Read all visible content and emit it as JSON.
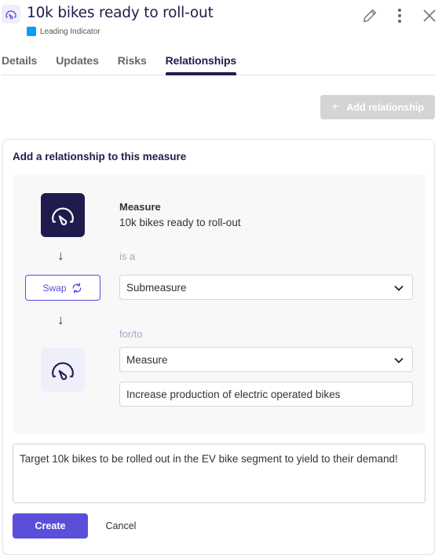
{
  "header": {
    "title": "10k bikes ready to roll-out",
    "title_icon": "gauge-icon",
    "tag": {
      "label": "Leading Indicator",
      "color": "#0b9cf7"
    },
    "actions": [
      {
        "name": "edit",
        "icon": "pencil-icon"
      },
      {
        "name": "more",
        "icon": "kebab-icon"
      },
      {
        "name": "close",
        "icon": "close-icon"
      }
    ]
  },
  "tabs": [
    {
      "label": "Details",
      "active": false
    },
    {
      "label": "Updates",
      "active": false
    },
    {
      "label": "Risks",
      "active": false
    },
    {
      "label": "Relationships",
      "active": true
    }
  ],
  "toolbar": {
    "add_relationship_label": "Add relationship",
    "add_relationship_icon": "plus-icon",
    "add_relationship_disabled": true
  },
  "form": {
    "title": "Add a relationship to this measure",
    "source": {
      "type_label": "Measure",
      "name": "10k bikes ready to roll-out",
      "icon": "gauge-icon"
    },
    "relation_label": "is a",
    "relation_select": {
      "value": "Submeasure"
    },
    "swap_label": "Swap",
    "swap_icon": "refresh-icon",
    "target_label": "for/to",
    "target_type_select": {
      "value": "Measure"
    },
    "target_value": "Increase production of electric operated bikes",
    "target_icon": "gauge-icon",
    "description": "Target 10k bikes to be rolled out in the EV bike segment to yield to their demand!",
    "create_label": "Create",
    "cancel_label": "Cancel"
  },
  "colors": {
    "primary": "#5b4fd9",
    "navy": "#1f1c4d",
    "disabled": "#d4d4d4",
    "hint": "#a8a4c8"
  }
}
